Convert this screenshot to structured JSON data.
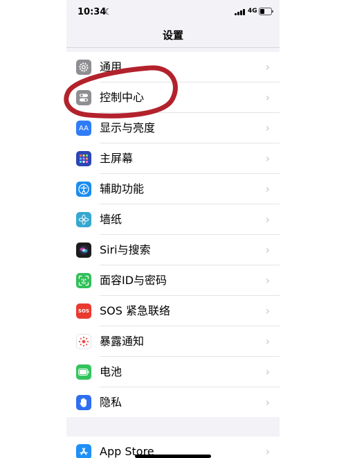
{
  "status": {
    "time": "10:34",
    "network": "4G"
  },
  "nav": {
    "title": "设置"
  },
  "settings": [
    {
      "label": "通用",
      "icon": "gear-icon",
      "color": "#8e8e93"
    },
    {
      "label": "控制中心",
      "icon": "toggle-switches-icon",
      "color": "#8e8e93"
    },
    {
      "label": "显示与亮度",
      "icon": "aa-text-icon",
      "glyph": "AA",
      "color": "#2f7cf6"
    },
    {
      "label": "主屏幕",
      "icon": "home-screen-grid-icon",
      "color": "#2d45b5"
    },
    {
      "label": "辅助功能",
      "icon": "accessibility-person-icon",
      "color": "#1a8cf0"
    },
    {
      "label": "墙纸",
      "icon": "flower-icon",
      "color": "#35a8d0"
    },
    {
      "label": "Siri与搜索",
      "icon": "siri-orb-icon",
      "color": "#1c1c1e"
    },
    {
      "label": "面容ID与密码",
      "icon": "face-id-icon",
      "color": "#32c05a"
    },
    {
      "label": "SOS 紧急联络",
      "icon": "sos-icon",
      "glyph": "SOS",
      "color": "#e93a30"
    },
    {
      "label": "暴露通知",
      "icon": "exposure-notification-icon",
      "color": "#ffffff"
    },
    {
      "label": "电池",
      "icon": "battery-icon",
      "color": "#33c45c"
    },
    {
      "label": "隐私",
      "icon": "hand-icon",
      "color": "#2f6ff0"
    }
  ],
  "apps": [
    {
      "label": "App Store",
      "icon": "app-store-icon",
      "color": "#1e8ff5"
    }
  ],
  "annotation": {
    "color": "#b3222c"
  }
}
